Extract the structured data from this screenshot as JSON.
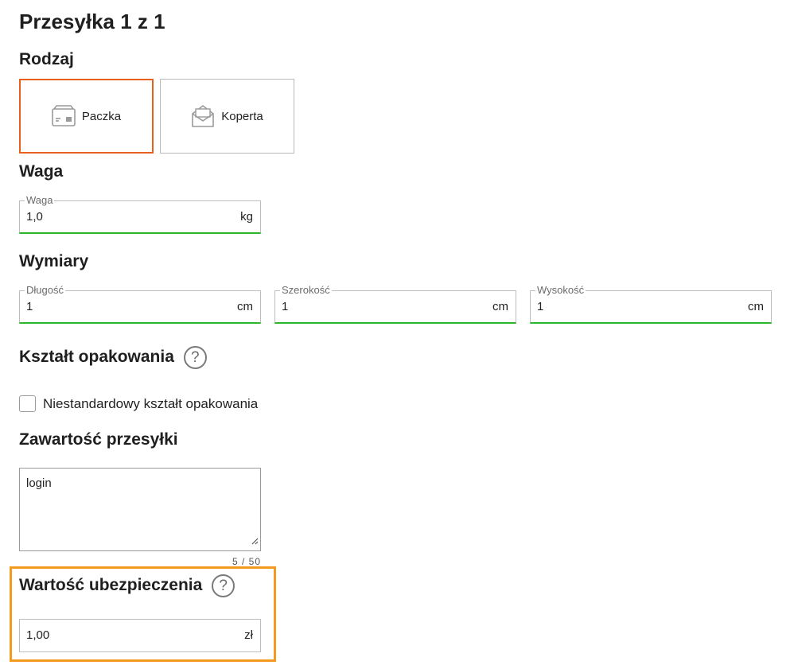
{
  "title": "Przesyłka 1 z 1",
  "type_section": {
    "heading": "Rodzaj",
    "options": [
      {
        "label": "Paczka",
        "icon": "package-icon",
        "selected": true
      },
      {
        "label": "Koperta",
        "icon": "envelope-icon",
        "selected": false
      }
    ]
  },
  "weight_section": {
    "heading": "Waga",
    "field": {
      "label": "Waga",
      "value": "1,0",
      "unit": "kg"
    }
  },
  "dimensions_section": {
    "heading": "Wymiary",
    "fields": [
      {
        "label": "Długość",
        "value": "1",
        "unit": "cm"
      },
      {
        "label": "Szerokość",
        "value": "1",
        "unit": "cm"
      },
      {
        "label": "Wysokość",
        "value": "1",
        "unit": "cm"
      }
    ]
  },
  "shape_section": {
    "heading": "Kształt opakowania",
    "help": "?",
    "checkbox_label": "Niestandardowy kształt opakowania",
    "checked": false
  },
  "contents_section": {
    "heading": "Zawartość przesyłki",
    "value": "login",
    "counter": "5 / 50"
  },
  "insurance_section": {
    "heading": "Wartość ubezpieczenia",
    "help": "?",
    "field": {
      "value": "1,00",
      "unit": "zł"
    }
  },
  "colors": {
    "selected_border": "#e9601c",
    "valid_underline": "#2db52d",
    "highlight_box": "#f39a1f"
  }
}
